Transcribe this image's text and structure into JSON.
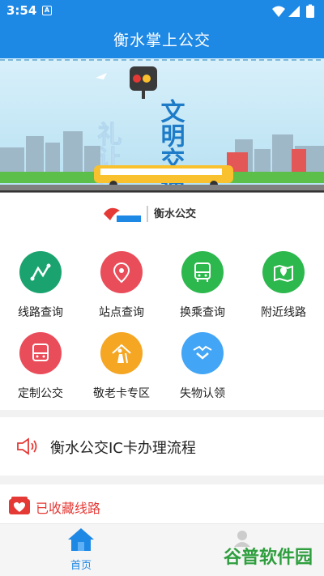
{
  "status_bar": {
    "time": "3:54",
    "notification_icon": "a-icon"
  },
  "app_bar": {
    "title": "衡水掌上公交"
  },
  "banner": {
    "headline_left": "礼让出行",
    "headline_right": "文明交通"
  },
  "logo": {
    "text": "衡水公交"
  },
  "menu": {
    "items": [
      {
        "label": "线路查询",
        "color": "#1aa36f",
        "icon": "route-icon"
      },
      {
        "label": "站点查询",
        "color": "#ea4d5a",
        "icon": "location-pin-icon"
      },
      {
        "label": "换乘查询",
        "color": "#2db84e",
        "icon": "bus-icon"
      },
      {
        "label": "附近线路",
        "color": "#2db84e",
        "icon": "map-pin-icon"
      },
      {
        "label": "定制公交",
        "color": "#ea4d5a",
        "icon": "custom-bus-icon"
      },
      {
        "label": "敬老卡专区",
        "color": "#f5a623",
        "icon": "elderly-icon"
      },
      {
        "label": "失物认领",
        "color": "#42a5f5",
        "icon": "handshake-icon"
      }
    ]
  },
  "notice": {
    "text": "衡水公交IC卡办理流程",
    "icon": "speaker-icon"
  },
  "favorites": {
    "label": "已收藏线路",
    "icon": "heart-folder-icon"
  },
  "bottom_nav": {
    "home_label": "首页",
    "mine_icon": "user-icon"
  },
  "watermark": {
    "text": "谷普软件园"
  },
  "colors": {
    "primary": "#1e88e5",
    "accent_red": "#e53935"
  }
}
